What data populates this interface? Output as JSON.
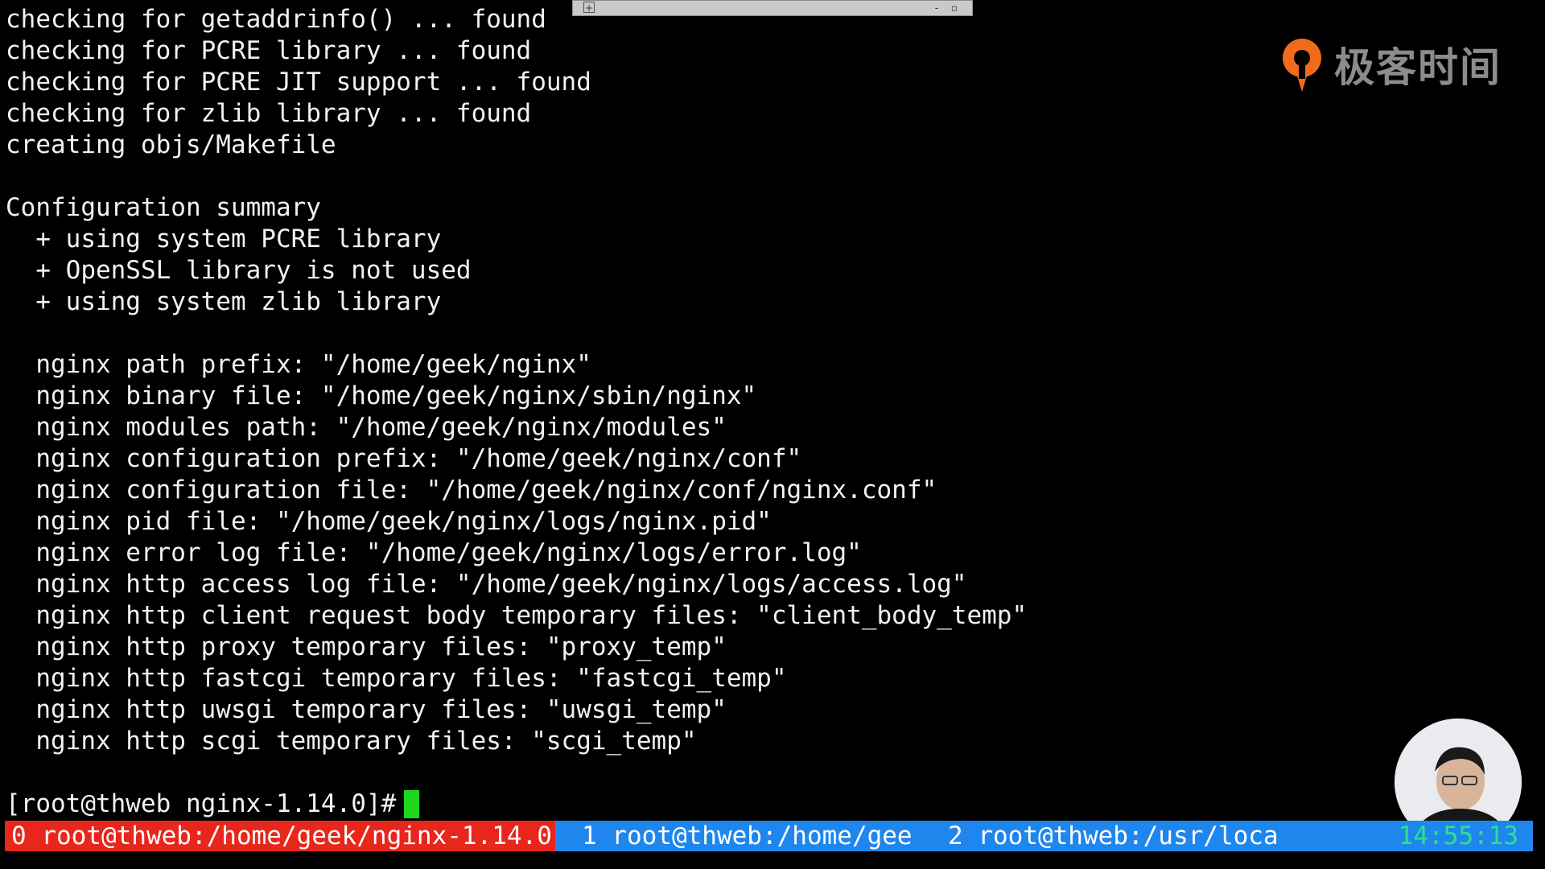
{
  "terminal": {
    "lines": [
      "checking for getaddrinfo() ... found",
      "checking for PCRE library ... found",
      "checking for PCRE JIT support ... found",
      "checking for zlib library ... found",
      "creating objs/Makefile",
      "",
      "Configuration summary",
      "  + using system PCRE library",
      "  + OpenSSL library is not used",
      "  + using system zlib library",
      "",
      "  nginx path prefix: \"/home/geek/nginx\"",
      "  nginx binary file: \"/home/geek/nginx/sbin/nginx\"",
      "  nginx modules path: \"/home/geek/nginx/modules\"",
      "  nginx configuration prefix: \"/home/geek/nginx/conf\"",
      "  nginx configuration file: \"/home/geek/nginx/conf/nginx.conf\"",
      "  nginx pid file: \"/home/geek/nginx/logs/nginx.pid\"",
      "  nginx error log file: \"/home/geek/nginx/logs/error.log\"",
      "  nginx http access log file: \"/home/geek/nginx/logs/access.log\"",
      "  nginx http client request body temporary files: \"client_body_temp\"",
      "  nginx http proxy temporary files: \"proxy_temp\"",
      "  nginx http fastcgi temporary files: \"fastcgi_temp\"",
      "  nginx http uwsgi temporary files: \"uwsgi_temp\"",
      "  nginx http scgi temporary files: \"scgi_temp\"",
      ""
    ],
    "prompt": "[root@thweb nginx-1.14.0]#"
  },
  "logo": {
    "text": "极客时间",
    "icon": "geektime-logo-icon",
    "color": "#f26b1d"
  },
  "mini_window": {
    "pin_glyph": "+",
    "controls": "- ▫"
  },
  "statusbar": {
    "tabs": [
      {
        "label": "0 root@thweb:/home/geek/nginx-1.14.0",
        "active": true
      },
      {
        "label": "1 root@thweb:/home/gee",
        "active": false
      },
      {
        "label": "2 root@thweb:/usr/loca",
        "active": false
      }
    ],
    "clock": "14:55:13",
    "colors": {
      "bar": "#1f86ee",
      "active_tab": "#e8261c",
      "clock": "#2fe08a"
    }
  },
  "avatar": {
    "icon": "presenter-webcam-icon"
  }
}
